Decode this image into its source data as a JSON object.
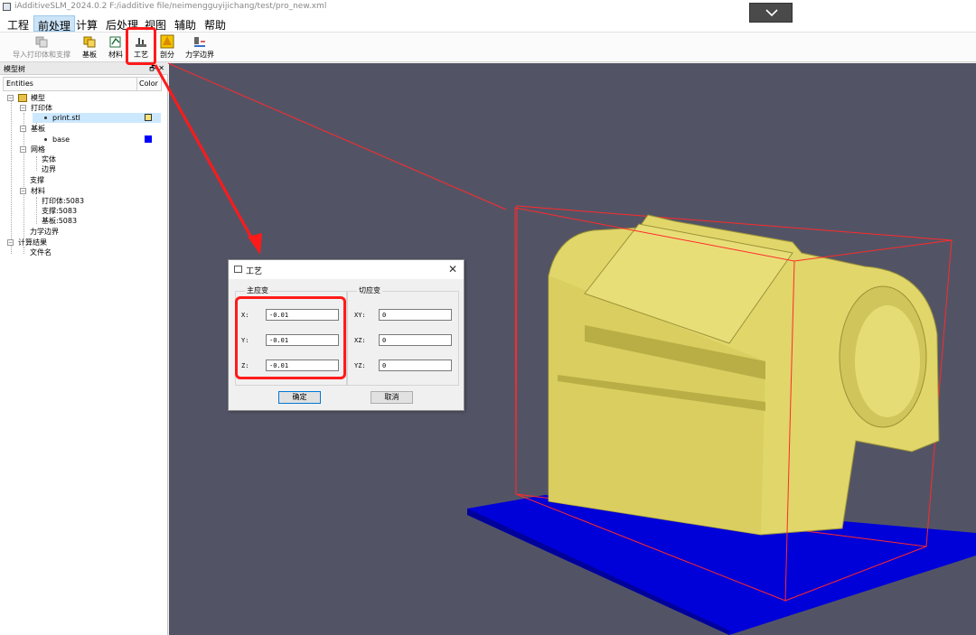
{
  "window": {
    "title": "iAdditiveSLM_2024.0.2 F:/iadditive file/neimengguyijichang/test/pro_new.xml",
    "collapse_icon": "chevron-down-icon"
  },
  "menu": {
    "items": [
      {
        "label": "工程"
      },
      {
        "label": "前处理"
      },
      {
        "label": "计算"
      },
      {
        "label": "后处理"
      },
      {
        "label": "视图"
      },
      {
        "label": "辅助"
      },
      {
        "label": "帮助"
      }
    ],
    "active": "前处理"
  },
  "toolbar": {
    "items": [
      {
        "label": "导入打印体和支撑",
        "icon": "import-icon",
        "enabled": false
      },
      {
        "label": "基板",
        "icon": "base-plate-icon",
        "enabled": true
      },
      {
        "label": "材料",
        "icon": "material-icon",
        "enabled": true
      },
      {
        "label": "工艺",
        "icon": "process-icon",
        "enabled": true
      },
      {
        "label": "剖分",
        "icon": "mesh-icon",
        "enabled": true
      },
      {
        "label": "力学边界",
        "icon": "boundary-icon",
        "enabled": true
      }
    ]
  },
  "model_tree": {
    "panel_title": "模型树",
    "panel_buttons": "🗗 ✕",
    "columns": [
      "Entities",
      "Color"
    ],
    "nodes": [
      {
        "label": "模型",
        "level": 0
      },
      {
        "label": "打印体",
        "level": 1
      },
      {
        "label": "print.stl",
        "level": 2,
        "color": "#f5e27a",
        "selected": true
      },
      {
        "label": "基板",
        "level": 1
      },
      {
        "label": "base",
        "level": 2,
        "color": "#0000ff"
      },
      {
        "label": "网格",
        "level": 1
      },
      {
        "label": "实体",
        "level": 2
      },
      {
        "label": "边界",
        "level": 2
      },
      {
        "label": "支撑",
        "level": 1
      },
      {
        "label": "材料",
        "level": 1
      },
      {
        "label": "打印体:5083",
        "level": 2
      },
      {
        "label": "支撑:5083",
        "level": 2
      },
      {
        "label": "基板:5083",
        "level": 2
      },
      {
        "label": "力学边界",
        "level": 1
      },
      {
        "label": "计算结果",
        "level": 0
      },
      {
        "label": "文件名",
        "level": 1
      }
    ]
  },
  "dialog": {
    "title": "工艺",
    "close": "✕",
    "principal_strain": {
      "title": "主应变",
      "fields": [
        {
          "label": "X:",
          "value": "-0.01"
        },
        {
          "label": "Y:",
          "value": "-0.01"
        },
        {
          "label": "Z:",
          "value": "-0.01"
        }
      ]
    },
    "shear_strain": {
      "title": "切应变",
      "fields": [
        {
          "label": "XY:",
          "value": "0"
        },
        {
          "label": "XZ:",
          "value": "0"
        },
        {
          "label": "YZ:",
          "value": "0"
        }
      ]
    },
    "ok_label": "确定",
    "cancel_label": "取消"
  },
  "colors": {
    "viewport_bg": "#525466",
    "part": "#e0d66a",
    "part_shadow": "#b9ae45",
    "base_plate": "#0000d8",
    "bounding_box": "#ff2a2a",
    "highlight": "#ff1a1a"
  }
}
